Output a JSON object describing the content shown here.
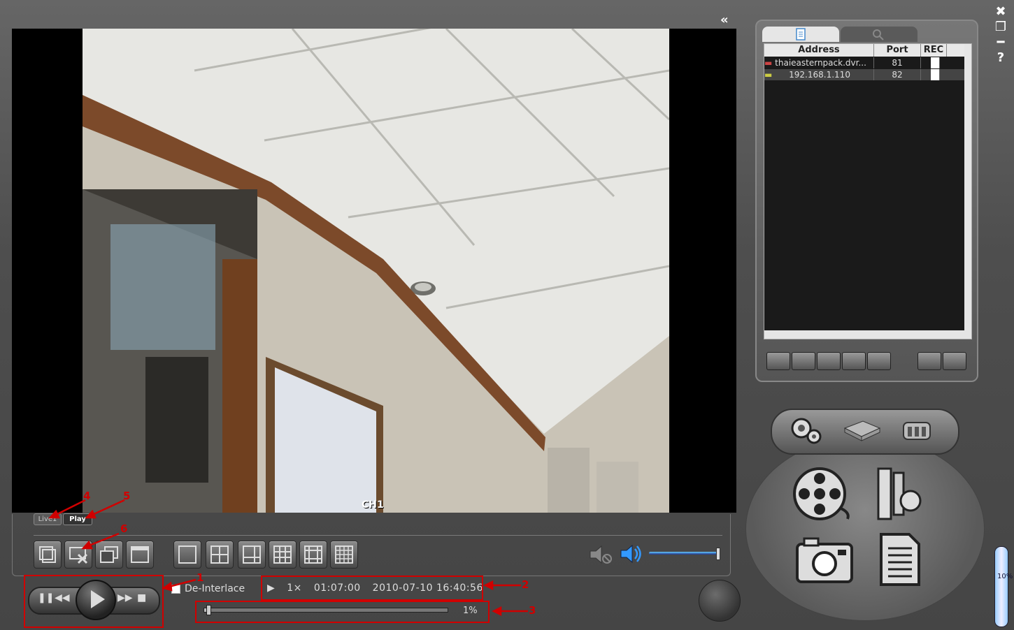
{
  "window": {
    "controls": [
      "✖",
      "❐",
      "━",
      "?"
    ]
  },
  "video": {
    "channel_label": "CH1"
  },
  "tabs": {
    "live": "Live1",
    "play": "Play"
  },
  "playback": {
    "deinterlace_label": "De-Interlace",
    "deinterlace_checked": false,
    "status_play_icon": "▶",
    "speed": "1×",
    "elapsed": "01:07:00",
    "datetime": "2010-07-10 16:40:56",
    "progress_percent": 1,
    "progress_label": "1%"
  },
  "annotations": [
    "1",
    "2",
    "3",
    "4",
    "5",
    "6"
  ],
  "device_list": {
    "columns": [
      "Address",
      "Port",
      "REC"
    ],
    "rows": [
      {
        "address": "thaieasternpack.dvr...",
        "port": "81"
      },
      {
        "address": "192.168.1.110",
        "port": "82"
      }
    ]
  },
  "volume": {
    "level_percent": 100
  },
  "zoom": {
    "label": "10%"
  },
  "colors": {
    "annotation": "#d00000",
    "panel": "#555555",
    "accent": "#3399ff"
  }
}
